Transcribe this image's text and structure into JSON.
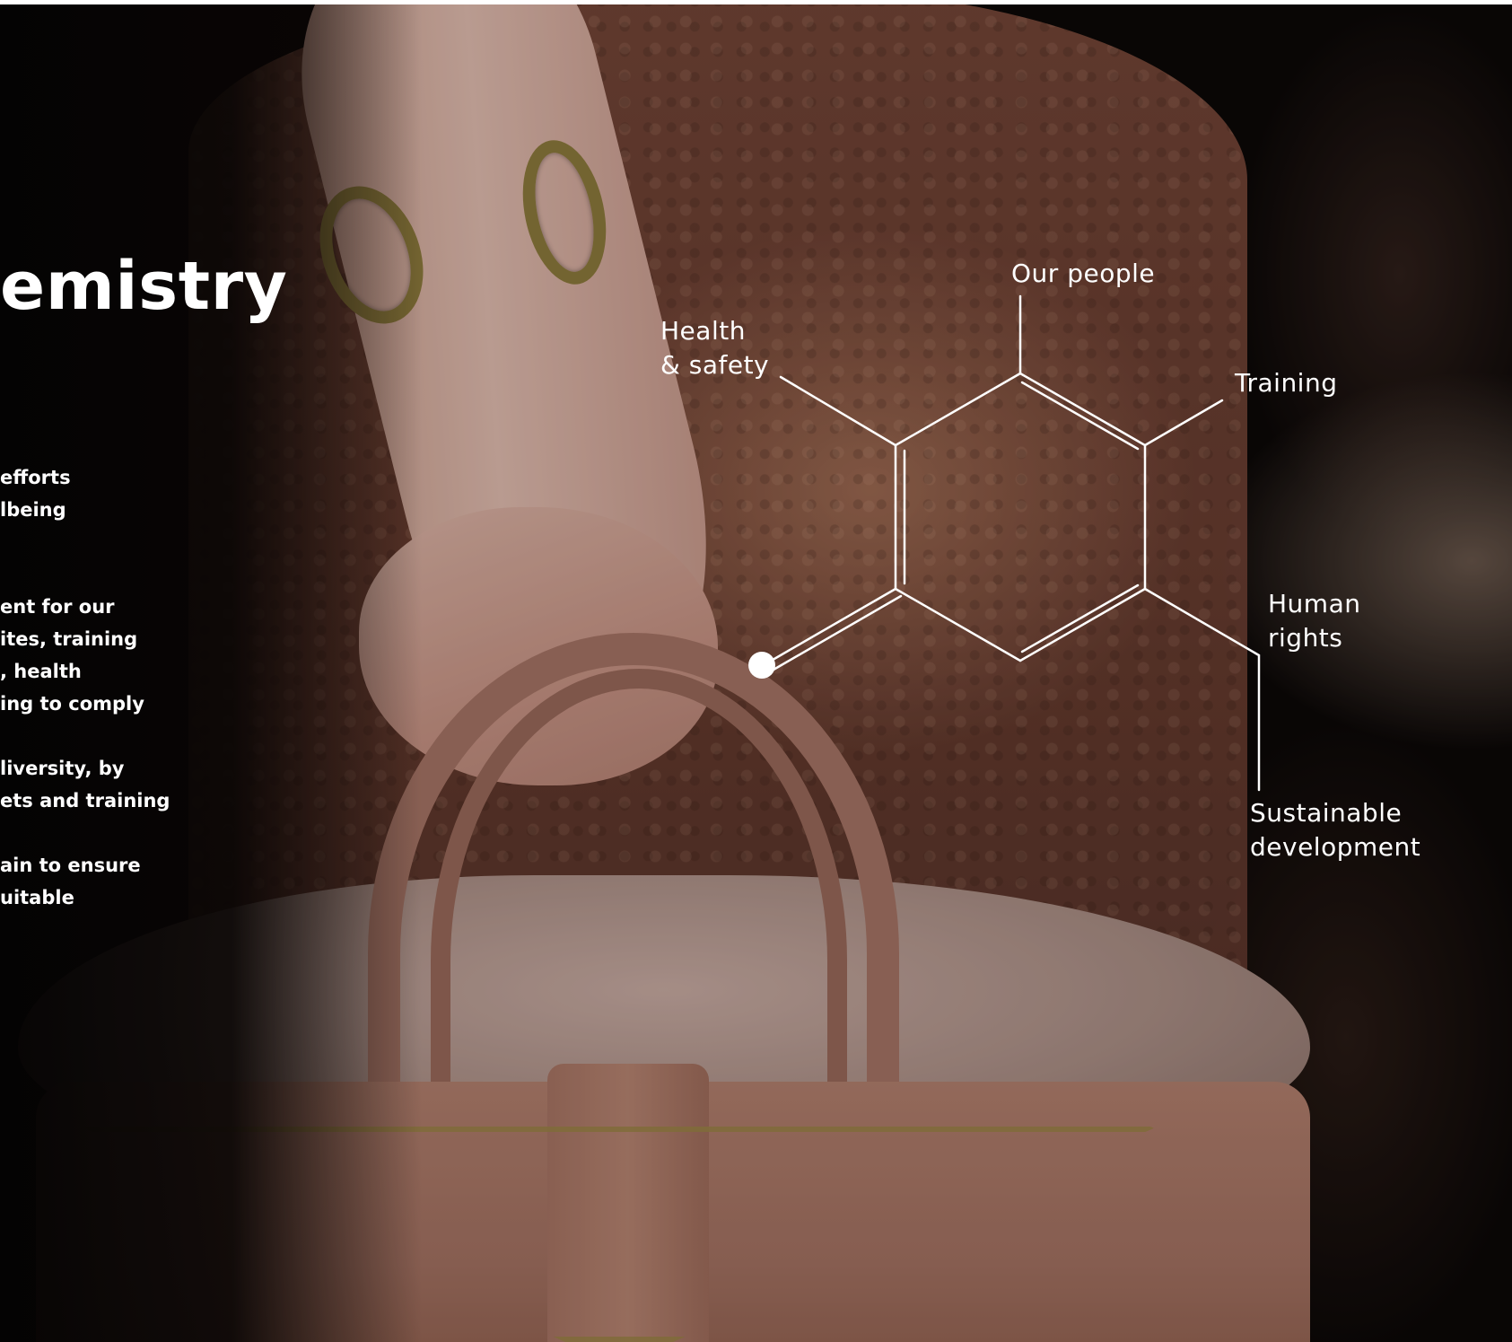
{
  "title_fragment": "emistry",
  "paragraphs": [
    {
      "lines": [
        "efforts",
        "lbeing"
      ]
    },
    {
      "lines": [
        "ent for our",
        "ites, training",
        ", health",
        "ing to comply"
      ]
    },
    {
      "lines": [
        "liversity, by",
        "ets and training"
      ]
    },
    {
      "lines": [
        "ain to ensure",
        "uitable"
      ]
    }
  ],
  "diagram": {
    "labels": {
      "our_people": "Our people",
      "health_safety": [
        "Health",
        "& safety"
      ],
      "training": "Training",
      "human_rights": [
        "Human",
        "rights"
      ],
      "sustainable_development": [
        "Sustainable",
        "development"
      ]
    },
    "line_color": "#ffffff"
  }
}
